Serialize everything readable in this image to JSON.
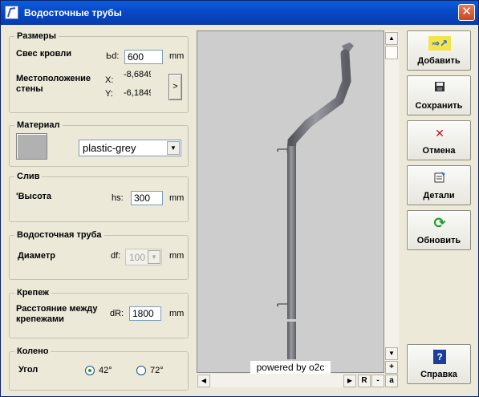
{
  "window": {
    "title": "Водосточные трубы",
    "close_label": "✕"
  },
  "sizes": {
    "legend": "Размеры",
    "eave_label": "Свес кровли",
    "eave_var": "Ьd:",
    "eave_value": "600",
    "eave_unit": "mm",
    "wall_label_1": "Местоположение",
    "wall_label_2": "стены",
    "x_label": "X:",
    "x_value": "-8,6849",
    "y_label": "Y:",
    "y_value": "-6,1849",
    "pick_label": ">"
  },
  "material": {
    "legend": "Материал",
    "selected": "plastic-grey",
    "swatch_color": "#b1b1b1"
  },
  "drain": {
    "legend": "Слив",
    "height_label": "'Высота",
    "height_var": "hs:",
    "height_value": "300",
    "height_unit": "mm"
  },
  "pipe": {
    "legend": "Водосточная труба",
    "diameter_label": "Диаметр",
    "diameter_var": "df:",
    "diameter_value": "100",
    "diameter_unit": "mm"
  },
  "fastening": {
    "legend": "Крепеж",
    "distance_label_1": "Расстояние между",
    "distance_label_2": "крепежами",
    "distance_var": "dR:",
    "distance_value": "1800",
    "distance_unit": "mm"
  },
  "elbow": {
    "legend": "Колено",
    "angle_label": "Угол",
    "option_1": "42°",
    "option_2": "72°",
    "selected": "42°"
  },
  "viewport": {
    "powered_by": "powered by o2c",
    "btn_r": "R",
    "btn_minus": "-",
    "btn_plus": "+",
    "btn_a": "a",
    "pipe_color": "#8a8a90"
  },
  "buttons": {
    "add": "Добавить",
    "save": "Сохранить",
    "cancel": "Отмена",
    "details": "Детали",
    "refresh": "Обновить",
    "help": "Справка"
  }
}
